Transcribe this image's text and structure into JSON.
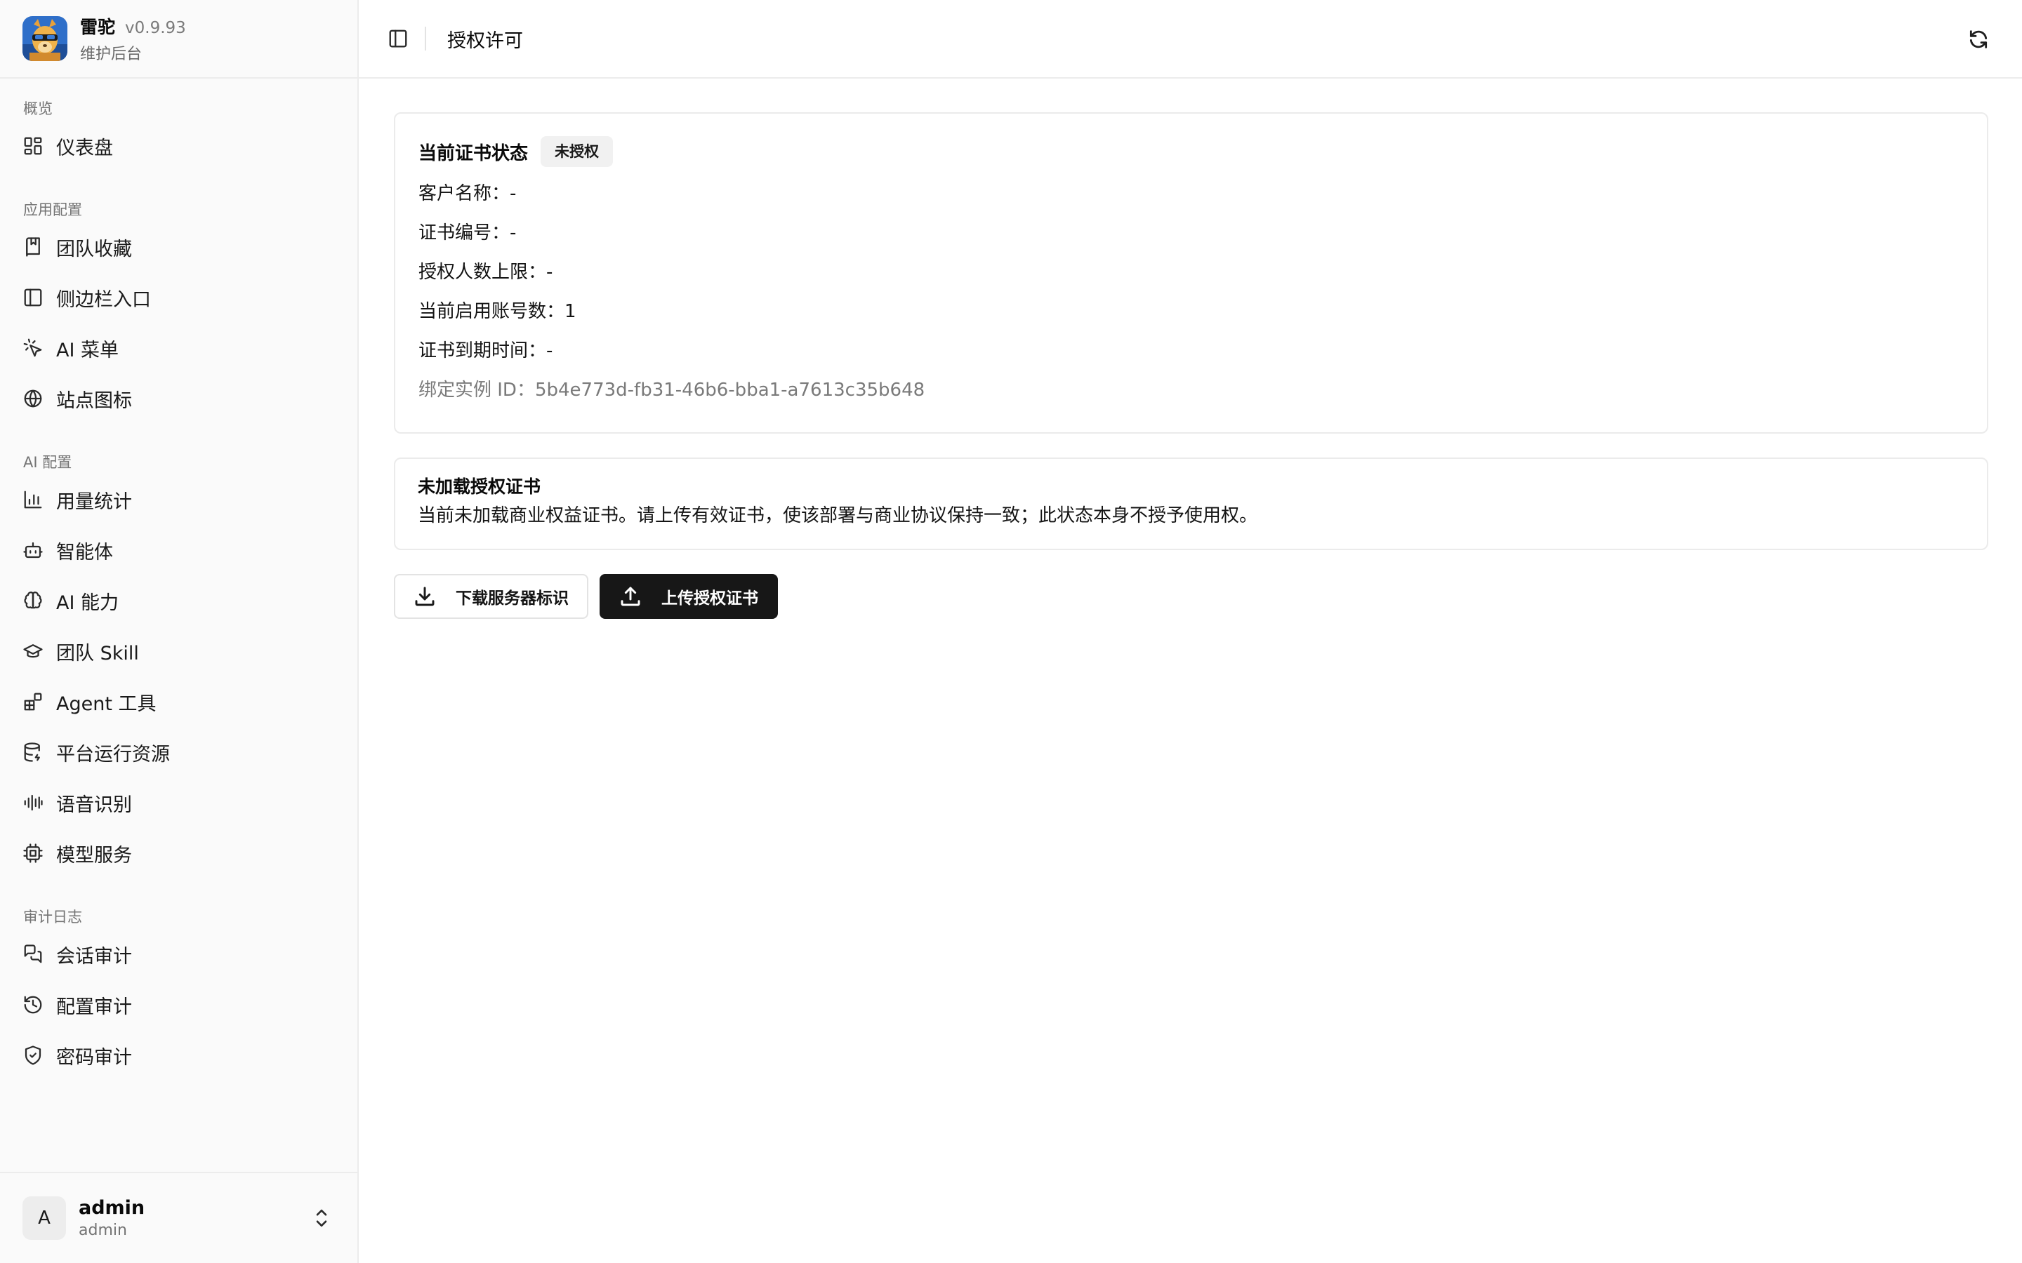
{
  "brand": {
    "name": "雷驼",
    "version": "v0.9.93",
    "subtitle": "维护后台",
    "logo_icon": "camel-mascot-logo"
  },
  "sidebar": {
    "groups": [
      {
        "label": "概览",
        "items": [
          {
            "label": "仪表盘",
            "icon": "dashboard-grid-icon"
          }
        ]
      },
      {
        "label": "应用配置",
        "items": [
          {
            "label": "团队收藏",
            "icon": "book-bookmark-icon"
          },
          {
            "label": "侧边栏入口",
            "icon": "panel-left-icon"
          },
          {
            "label": "AI 菜单",
            "icon": "cursor-click-icon"
          },
          {
            "label": "站点图标",
            "icon": "globe-icon"
          }
        ]
      },
      {
        "label": "AI 配置",
        "items": [
          {
            "label": "用量统计",
            "icon": "bar-chart-icon"
          },
          {
            "label": "智能体",
            "icon": "bot-icon"
          },
          {
            "label": "AI 能力",
            "icon": "brain-icon"
          },
          {
            "label": "团队 Skill",
            "icon": "graduation-cap-icon"
          },
          {
            "label": "Agent 工具",
            "icon": "blocks-icon"
          },
          {
            "label": "平台运行资源",
            "icon": "database-icon"
          },
          {
            "label": "语音识别",
            "icon": "audio-wave-icon"
          },
          {
            "label": "模型服务",
            "icon": "cpu-icon"
          }
        ]
      },
      {
        "label": "审计日志",
        "items": [
          {
            "label": "会话审计",
            "icon": "messages-icon"
          },
          {
            "label": "配置审计",
            "icon": "history-icon"
          },
          {
            "label": "密码审计",
            "icon": "shield-check-icon"
          }
        ]
      }
    ]
  },
  "user": {
    "avatar_letter": "A",
    "name": "admin",
    "role": "admin"
  },
  "header": {
    "title": "授权许可"
  },
  "license": {
    "status_title": "当前证书状态",
    "status_badge": "未授权",
    "customer_name": "客户名称：-",
    "cert_number": "证书编号：-",
    "seat_limit": "授权人数上限：-",
    "active_accounts": "当前启用账号数：1",
    "expiry": "证书到期时间：-",
    "instance_id": "绑定实例 ID：5b4e773d-fb31-46b6-bba1-a7613c35b648"
  },
  "notice": {
    "title": "未加载授权证书",
    "text": "当前未加载商业权益证书。请上传有效证书，使该部署与商业协议保持一致；此状态本身不授予使用权。"
  },
  "actions": {
    "download_label": "下载服务器标识",
    "upload_label": "上传授权证书"
  },
  "colors": {
    "accent": "#171717",
    "sidebar_bg": "#fafafa",
    "border": "#ebebeb"
  }
}
